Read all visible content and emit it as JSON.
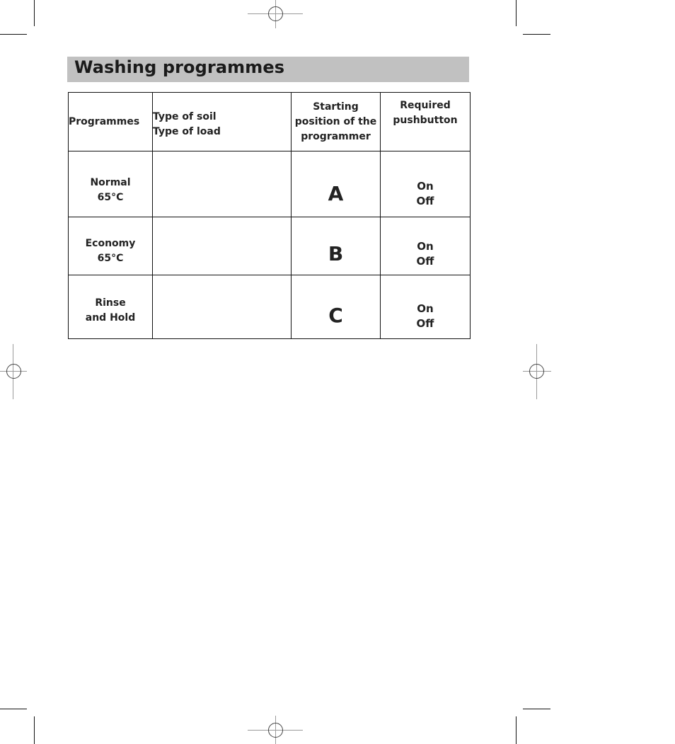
{
  "page": {
    "title": "Washing programmes"
  },
  "table": {
    "headers": {
      "programmes": "Programmes",
      "soil_line1": "Type of soil",
      "soil_line2": "Type of load",
      "start_line1": "Starting",
      "start_line2": "position of the",
      "start_line3": "programmer",
      "push_line1": "Required",
      "push_line2": "pushbutton"
    },
    "rows": [
      {
        "name_line1": "Normal",
        "name_line2": "65°C",
        "soil": "",
        "position": "A",
        "button_on": "On",
        "button_off": "Off"
      },
      {
        "name_line1": "Economy",
        "name_line2": "65°C",
        "soil": "",
        "position": "B",
        "button_on": "On",
        "button_off": "Off"
      },
      {
        "name_line1": "Rinse",
        "name_line2": "and Hold",
        "soil": "",
        "position": "C",
        "button_on": "On",
        "button_off": "Off"
      }
    ]
  }
}
